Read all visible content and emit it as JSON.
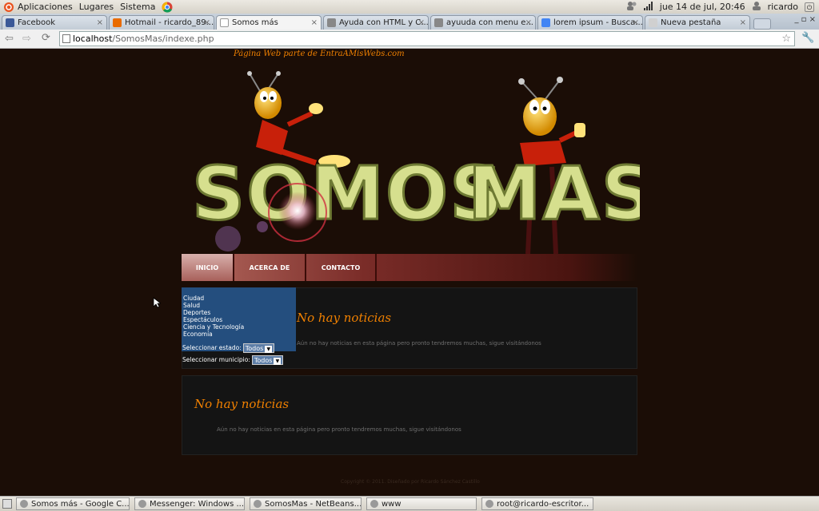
{
  "topbar": {
    "menus": [
      "Aplicaciones",
      "Lugares",
      "Sistema"
    ],
    "datetime": "jue 14 de jul, 20:46",
    "user": "ricardo"
  },
  "tabs": [
    {
      "label": "Facebook",
      "color": "#3b5998"
    },
    {
      "label": "Hotmail - ricardo_89...",
      "color": "#e96b00"
    },
    {
      "label": "Somos más",
      "color": "#ffffff"
    },
    {
      "label": "Ayuda con HTML y C...",
      "color": "#888888"
    },
    {
      "label": "ayuuda con menu e...",
      "color": "#888888"
    },
    {
      "label": "lorem ipsum - Busca...",
      "color": "#4285f4"
    },
    {
      "label": "Nueva pestaña",
      "color": "#d0d0d0"
    }
  ],
  "address": {
    "host": "localhost",
    "path": "/SomosMas/indexe.php"
  },
  "site": {
    "tagline": "Página Web parte de EntraAMisWebs.com",
    "logo_text": "SOMOS MAS",
    "menu": [
      "INICIO",
      "ACERCA DE",
      "CONTACTO"
    ],
    "categories": [
      "Ciudad",
      "Salud",
      "Deportes",
      "Espectáculos",
      "Ciencia y Tecnología",
      "Economía"
    ],
    "estado_label": "Seleccionar estado:",
    "estado_value": "Todos",
    "municipio_label": "Seleccionar municipio:",
    "municipio_value": "Todos",
    "news_title": "No hay noticias",
    "news_text": "Aún no hay noticias en esta página pero pronto tendremos muchas, sigue visitándonos",
    "footer": "Copyright © 2011. Diseñado por Ricardo Sánchez Castillo"
  },
  "taskbar": [
    "Somos más - Google C...",
    "Messenger: Windows ...",
    "SomosMas - NetBeans...",
    "www",
    "root@ricardo-escritor..."
  ],
  "colors": {
    "accent": "#f08000",
    "sidebar": "#244e7e",
    "page_bg": "#1b0d06"
  }
}
